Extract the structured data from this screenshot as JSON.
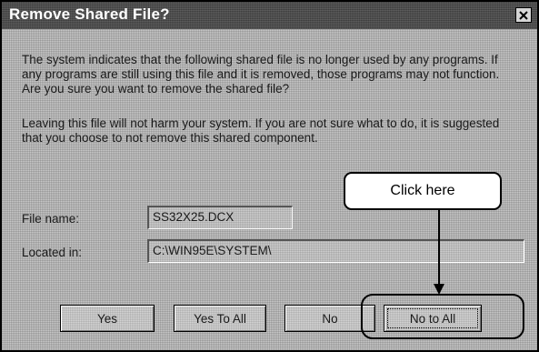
{
  "dialog": {
    "title": "Remove Shared File?",
    "message_1": "The system indicates that the following shared file is no longer used by any programs.  If any programs are still using this file and it is removed, those programs may not function.  Are you sure you want to remove the shared file?",
    "message_2": "Leaving this file will not harm your system.  If you are not sure what to do, it is suggested that you choose to not remove this shared component.",
    "file_name_label": "File name:",
    "file_name_value": "SS32X25.DCX",
    "located_in_label": "Located in:",
    "located_in_value": "C:\\WIN95E\\SYSTEM\\"
  },
  "buttons": {
    "yes_label": "Yes",
    "yes_to_all_label": "Yes To All",
    "no_label": "No",
    "no_to_all_label": "No to All"
  },
  "annotation": {
    "callout_text": "Click here"
  },
  "icons": {
    "close": "close-icon",
    "arrow": "arrow-down-icon"
  }
}
